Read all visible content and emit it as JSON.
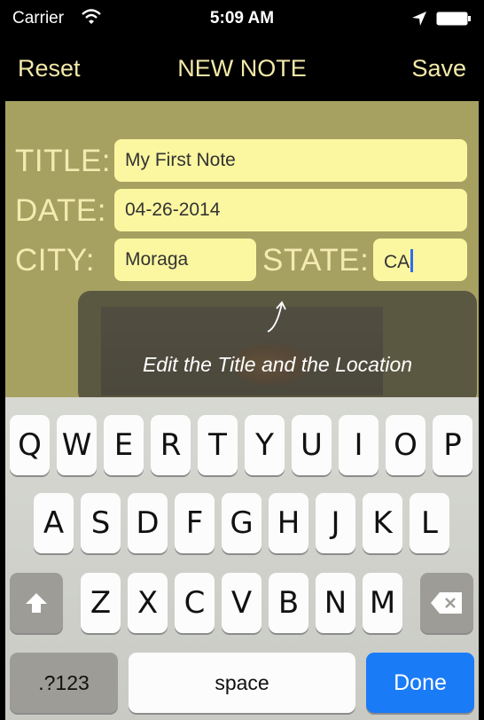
{
  "status_bar": {
    "carrier": "Carrier",
    "time": "5:09 AM"
  },
  "nav": {
    "reset": "Reset",
    "title": "NEW NOTE",
    "save": "Save"
  },
  "form": {
    "title_label": "TITLE:",
    "title_value": "My First Note",
    "date_label": "DATE:",
    "date_value": "04-26-2014",
    "city_label": "CITY:",
    "city_value": "Moraga",
    "state_label": "STATE:",
    "state_value": "CA"
  },
  "tooltip": {
    "text": "Edit the Title and the Location"
  },
  "keyboard": {
    "row1": [
      "Q",
      "W",
      "E",
      "R",
      "T",
      "Y",
      "U",
      "I",
      "O",
      "P"
    ],
    "row2": [
      "A",
      "S",
      "D",
      "F",
      "G",
      "H",
      "J",
      "K",
      "L"
    ],
    "row3": [
      "Z",
      "X",
      "C",
      "V",
      "B",
      "N",
      "M"
    ],
    "numbers": ".?123",
    "space": "space",
    "done": "Done"
  },
  "colors": {
    "background": "#a6a161",
    "field": "#fbf6a0",
    "label": "#f3ebb1",
    "nav_text": "#f3e9a9",
    "done": "#1a7bf7"
  }
}
